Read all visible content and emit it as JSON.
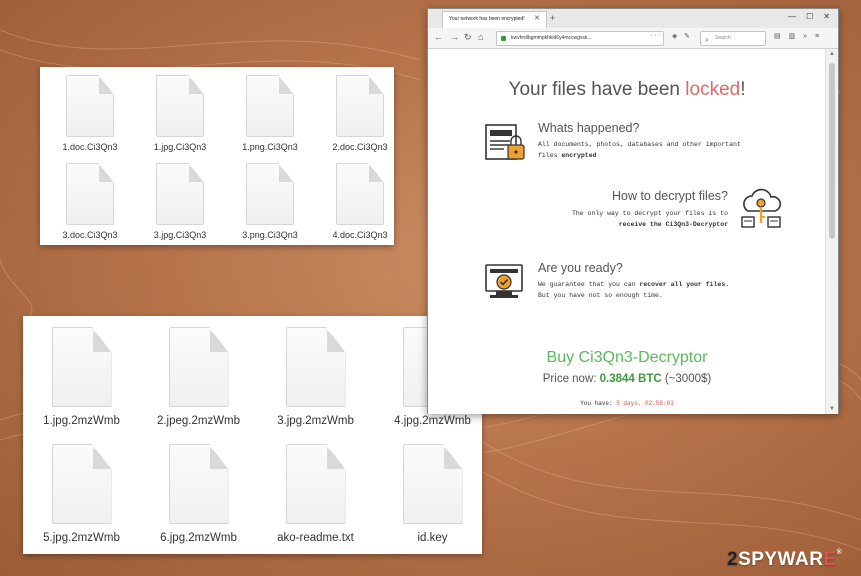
{
  "explorer_top": {
    "files": [
      {
        "name": "1.doc.Ci3Qn3"
      },
      {
        "name": "1.jpg.Ci3Qn3"
      },
      {
        "name": "1.png.Ci3Qn3"
      },
      {
        "name": "2.doc.Ci3Qn3"
      },
      {
        "name": "3.doc.Ci3Qn3"
      },
      {
        "name": "3.jpg.Ci3Qn3"
      },
      {
        "name": "3.png.Ci3Qn3"
      },
      {
        "name": "4.doc.Ci3Qn3"
      }
    ]
  },
  "explorer_bottom": {
    "files": [
      {
        "name": "1.jpg.2mzWmb"
      },
      {
        "name": "2.jpeg.2mzWmb"
      },
      {
        "name": "3.jpg.2mzWmb"
      },
      {
        "name": "4.jpg.2mzWmb"
      },
      {
        "name": "5.jpg.2mzWmb"
      },
      {
        "name": "6.jpg.2mzWmb"
      },
      {
        "name": "ako-readme.txt"
      },
      {
        "name": "id.key"
      }
    ]
  },
  "browser": {
    "tab_title": "Your network has been encrypted!",
    "url": "kwvhrdibgmmpkhkid6y4mccwgxsk...",
    "search_placeholder": "Search",
    "page": {
      "headline_prefix": "Your files have been ",
      "headline_accent": "locked",
      "headline_suffix": "!",
      "section1_title": "Whats happened?",
      "section1_text_1": "All documents, photos, databases and other important",
      "section1_text_2": "files ",
      "section1_text_bold": "encrypted",
      "section2_title": "How to decrypt files?",
      "section2_text_1": "The only way to decrypt your files is to",
      "section2_text_bold": "receive the Ci3Qn3-Decryptor",
      "section3_title": "Are you ready?",
      "section3_text_1": "We guarantee that you can ",
      "section3_text_bold": "recover all your files.",
      "section3_text_2": "But you have not so enough time.",
      "buy_title": "Buy Ci3Qn3-Decryptor",
      "price_label": "Price now: ",
      "price_btc": "0.3844 BTC",
      "price_usd": " (~3000$)",
      "timer_label": "You have: ",
      "timer_value": "5 days. 02:58:03"
    }
  },
  "watermark": {
    "prefix_num": "2",
    "text": "SPYWAR",
    "suffix": "E",
    "mark": "®"
  },
  "colors": {
    "accent_red": "#e06a6a",
    "buy_green": "#5cb85c",
    "icon_orange": "#f0a030"
  }
}
